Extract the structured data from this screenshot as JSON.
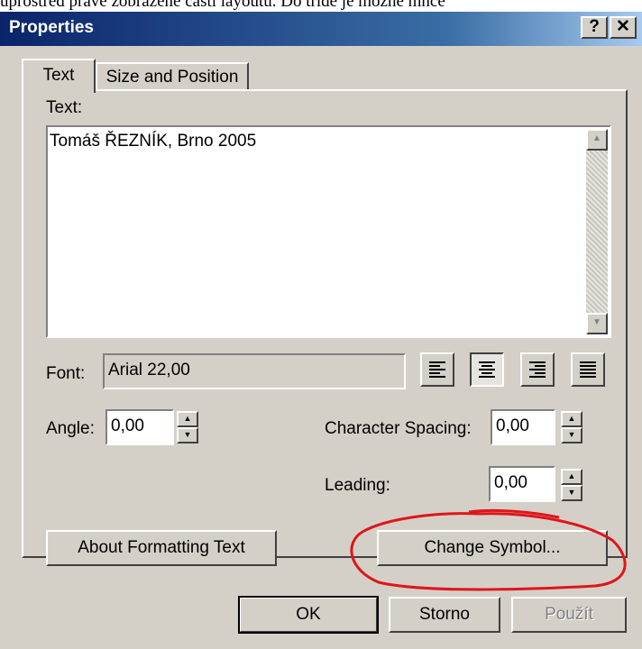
{
  "background_text": "uprostřed právě zobrazené části layoutu. Do třídě je možné mnče",
  "window": {
    "title": "Properties",
    "help_glyph": "?",
    "close_glyph": "✕"
  },
  "tabs": [
    {
      "label": "Text",
      "active": true
    },
    {
      "label": "Size and Position",
      "active": false
    }
  ],
  "text_section": {
    "label": "Text:",
    "value": "Tomáš ŘEZNÍK, Brno 2005"
  },
  "font": {
    "label": "Font:",
    "value": "Arial 22,00"
  },
  "alignment": {
    "options": [
      "align-left",
      "align-center",
      "align-right",
      "align-justify"
    ],
    "selected": "align-center"
  },
  "angle": {
    "label": "Angle:",
    "value": "0,00"
  },
  "character_spacing": {
    "label": "Character Spacing:",
    "value": "0,00"
  },
  "leading": {
    "label": "Leading:",
    "value": "0,00"
  },
  "buttons": {
    "about_formatting": "About Formatting Text",
    "change_symbol": "Change Symbol...",
    "ok": "OK",
    "cancel": "Storno",
    "apply": "Použít"
  },
  "colors": {
    "dialog_face": "#d4d0c8",
    "title_start": "#0a246a",
    "annotation": "#e0151b"
  }
}
